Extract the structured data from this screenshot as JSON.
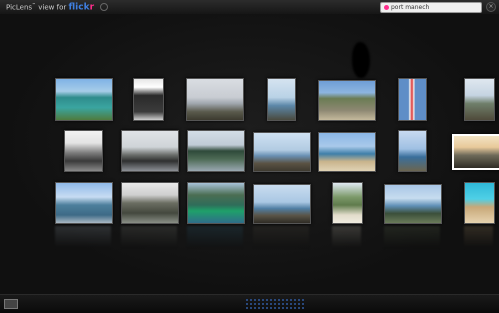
{
  "app": {
    "name": "PicLens",
    "view_for": "view for",
    "service_a": "flick",
    "service_b": "r"
  },
  "search": {
    "value": "port manech"
  },
  "photos": [
    {
      "name": "lagoon-coast"
    },
    {
      "name": "hiker-back"
    },
    {
      "name": "sailboat-rocks"
    },
    {
      "name": "rocky-sea"
    },
    {
      "name": "headland-houses"
    },
    {
      "name": "lighthouse"
    },
    {
      "name": "cliff-sea"
    },
    {
      "name": "crowd-people"
    },
    {
      "name": "grey-sea-rocks"
    },
    {
      "name": "boats-coast"
    },
    {
      "name": "rocks-shore"
    },
    {
      "name": "bay-beach"
    },
    {
      "name": "coastline-blue"
    },
    {
      "name": "sunset-panorama"
    },
    {
      "name": "harbor-boats"
    },
    {
      "name": "grey-cliffs"
    },
    {
      "name": "green-boats"
    },
    {
      "name": "shore-stones"
    },
    {
      "name": "beach-trees"
    },
    {
      "name": "rocky-island"
    },
    {
      "name": "pool-edge"
    }
  ]
}
